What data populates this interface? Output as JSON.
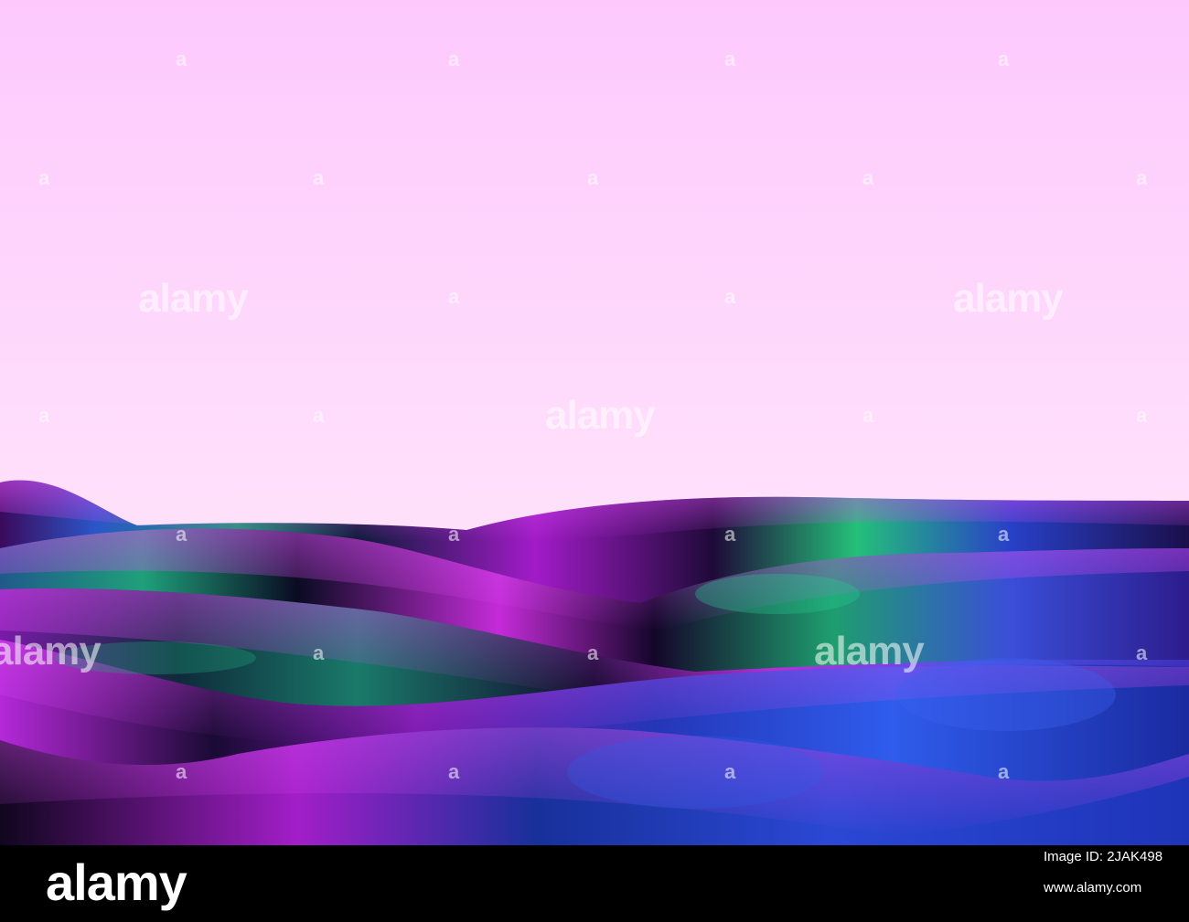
{
  "watermark": {
    "logo_text": "alamy",
    "mark_text": "a"
  },
  "footer": {
    "brand": "alamy",
    "image_id": "Image ID: 2JAK498",
    "url": "www.alamy.com"
  },
  "colors": {
    "sky_top": "#FDC9FD",
    "sky_bottom": "#FFE5FB",
    "fabric_purple": "#B21ED4",
    "fabric_green": "#1C9A6E",
    "fabric_blue": "#2A3EDA",
    "fabric_shadow": "#14062A"
  }
}
